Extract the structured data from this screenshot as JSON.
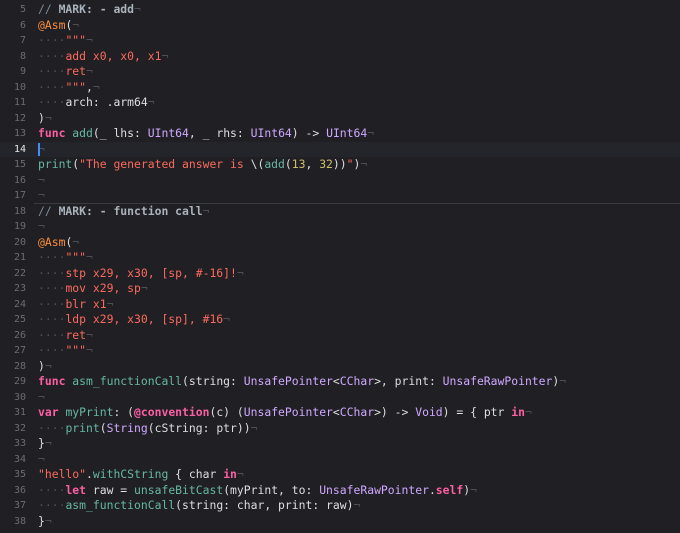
{
  "editor": {
    "current_line": "14",
    "lines": [
      {
        "n": "5",
        "t": [
          [
            "comment",
            "// "
          ],
          [
            "mark",
            "MARK: - add"
          ],
          [
            "inv",
            "¬"
          ]
        ]
      },
      {
        "n": "6",
        "t": [
          [
            "attr",
            "@Asm"
          ],
          [
            "plain",
            "("
          ],
          [
            "inv",
            "¬"
          ]
        ]
      },
      {
        "n": "7",
        "t": [
          [
            "inv",
            "····"
          ],
          [
            "str",
            "\"\"\""
          ],
          [
            "inv",
            "¬"
          ]
        ]
      },
      {
        "n": "8",
        "t": [
          [
            "inv",
            "····"
          ],
          [
            "str",
            "add x0, x0, x1"
          ],
          [
            "inv",
            "¬"
          ]
        ]
      },
      {
        "n": "9",
        "t": [
          [
            "inv",
            "····"
          ],
          [
            "str",
            "ret"
          ],
          [
            "inv",
            "¬"
          ]
        ]
      },
      {
        "n": "10",
        "t": [
          [
            "inv",
            "····"
          ],
          [
            "str",
            "\"\"\""
          ],
          [
            "plain",
            ","
          ],
          [
            "inv",
            "¬"
          ]
        ]
      },
      {
        "n": "11",
        "t": [
          [
            "inv",
            "····"
          ],
          [
            "plain",
            "arch: .arm64"
          ],
          [
            "inv",
            "¬"
          ]
        ]
      },
      {
        "n": "12",
        "t": [
          [
            "plain",
            ")"
          ],
          [
            "inv",
            "¬"
          ]
        ]
      },
      {
        "n": "13",
        "t": [
          [
            "kw",
            "func"
          ],
          [
            "plain",
            " "
          ],
          [
            "func",
            "add"
          ],
          [
            "plain",
            "(_ lhs: "
          ],
          [
            "type",
            "UInt64"
          ],
          [
            "plain",
            ", _ rhs: "
          ],
          [
            "type",
            "UInt64"
          ],
          [
            "plain",
            ") -> "
          ],
          [
            "type",
            "UInt64"
          ],
          [
            "inv",
            "¬"
          ]
        ]
      },
      {
        "n": "14",
        "t": [
          [
            "inv",
            "¬"
          ]
        ]
      },
      {
        "n": "15",
        "t": [
          [
            "func",
            "print"
          ],
          [
            "plain",
            "("
          ],
          [
            "str",
            "\"The generated answer is "
          ],
          [
            "plain",
            "\\("
          ],
          [
            "func",
            "add"
          ],
          [
            "plain",
            "("
          ],
          [
            "num",
            "13"
          ],
          [
            "plain",
            ", "
          ],
          [
            "num",
            "32"
          ],
          [
            "plain",
            "))"
          ],
          [
            "str",
            "\""
          ],
          [
            "plain",
            ")"
          ],
          [
            "inv",
            "¬"
          ]
        ]
      },
      {
        "n": "16",
        "t": [
          [
            "inv",
            "¬"
          ]
        ]
      },
      {
        "n": "17",
        "t": [
          [
            "inv",
            "¬"
          ]
        ]
      },
      {
        "n": "18",
        "t": [
          [
            "comment",
            "// "
          ],
          [
            "mark",
            "MARK: - function call"
          ],
          [
            "inv",
            "¬"
          ]
        ]
      },
      {
        "n": "19",
        "t": [
          [
            "inv",
            "¬"
          ]
        ]
      },
      {
        "n": "20",
        "t": [
          [
            "attr",
            "@Asm"
          ],
          [
            "plain",
            "("
          ],
          [
            "inv",
            "¬"
          ]
        ]
      },
      {
        "n": "21",
        "t": [
          [
            "inv",
            "····"
          ],
          [
            "str",
            "\"\"\""
          ],
          [
            "inv",
            "¬"
          ]
        ]
      },
      {
        "n": "22",
        "t": [
          [
            "inv",
            "····"
          ],
          [
            "str",
            "stp x29, x30, [sp, #-16]!"
          ],
          [
            "inv",
            "¬"
          ]
        ]
      },
      {
        "n": "23",
        "t": [
          [
            "inv",
            "····"
          ],
          [
            "str",
            "mov x29, sp"
          ],
          [
            "inv",
            "¬"
          ]
        ]
      },
      {
        "n": "24",
        "t": [
          [
            "inv",
            "····"
          ],
          [
            "str",
            "blr x1"
          ],
          [
            "inv",
            "¬"
          ]
        ]
      },
      {
        "n": "25",
        "t": [
          [
            "inv",
            "····"
          ],
          [
            "str",
            "ldp x29, x30, [sp], #16"
          ],
          [
            "inv",
            "¬"
          ]
        ]
      },
      {
        "n": "26",
        "t": [
          [
            "inv",
            "····"
          ],
          [
            "str",
            "ret"
          ],
          [
            "inv",
            "¬"
          ]
        ]
      },
      {
        "n": "27",
        "t": [
          [
            "inv",
            "····"
          ],
          [
            "str",
            "\"\"\""
          ],
          [
            "inv",
            "¬"
          ]
        ]
      },
      {
        "n": "28",
        "t": [
          [
            "plain",
            ")"
          ],
          [
            "inv",
            "¬"
          ]
        ]
      },
      {
        "n": "29",
        "t": [
          [
            "kw",
            "func"
          ],
          [
            "plain",
            " "
          ],
          [
            "func",
            "asm_functionCall"
          ],
          [
            "plain",
            "(string: "
          ],
          [
            "type",
            "UnsafePointer"
          ],
          [
            "plain",
            "<"
          ],
          [
            "type",
            "CChar"
          ],
          [
            "plain",
            ">, print: "
          ],
          [
            "type",
            "UnsafeRawPointer"
          ],
          [
            "plain",
            ")"
          ],
          [
            "inv",
            "¬"
          ]
        ]
      },
      {
        "n": "30",
        "t": [
          [
            "inv",
            "¬"
          ]
        ]
      },
      {
        "n": "31",
        "t": [
          [
            "kw",
            "var"
          ],
          [
            "plain",
            " "
          ],
          [
            "func",
            "myPrint"
          ],
          [
            "plain",
            ": ("
          ],
          [
            "kw",
            "@convention"
          ],
          [
            "plain",
            "(c) ("
          ],
          [
            "type",
            "UnsafePointer"
          ],
          [
            "plain",
            "<"
          ],
          [
            "type",
            "CChar"
          ],
          [
            "plain",
            ">) -> "
          ],
          [
            "type",
            "Void"
          ],
          [
            "plain",
            ") = { ptr "
          ],
          [
            "kw",
            "in"
          ],
          [
            "inv",
            "¬"
          ]
        ]
      },
      {
        "n": "32",
        "t": [
          [
            "inv",
            "····"
          ],
          [
            "func",
            "print"
          ],
          [
            "plain",
            "("
          ],
          [
            "type",
            "String"
          ],
          [
            "plain",
            "(cString: ptr))"
          ],
          [
            "inv",
            "¬"
          ]
        ]
      },
      {
        "n": "33",
        "t": [
          [
            "plain",
            "}"
          ],
          [
            "inv",
            "¬"
          ]
        ]
      },
      {
        "n": "34",
        "t": [
          [
            "inv",
            "¬"
          ]
        ]
      },
      {
        "n": "35",
        "t": [
          [
            "str",
            "\"hello\""
          ],
          [
            "plain",
            "."
          ],
          [
            "func",
            "withCString"
          ],
          [
            "plain",
            " { char "
          ],
          [
            "kw",
            "in"
          ],
          [
            "inv",
            "¬"
          ]
        ]
      },
      {
        "n": "36",
        "t": [
          [
            "inv",
            "····"
          ],
          [
            "kw",
            "let"
          ],
          [
            "plain",
            " raw = "
          ],
          [
            "func",
            "unsafeBitCast"
          ],
          [
            "plain",
            "(myPrint, to: "
          ],
          [
            "type",
            "UnsafeRawPointer"
          ],
          [
            "plain",
            "."
          ],
          [
            "kw",
            "self"
          ],
          [
            "plain",
            ")"
          ],
          [
            "inv",
            "¬"
          ]
        ]
      },
      {
        "n": "37",
        "t": [
          [
            "inv",
            "····"
          ],
          [
            "func",
            "asm_functionCall"
          ],
          [
            "plain",
            "(string: char, print: raw)"
          ],
          [
            "inv",
            "¬"
          ]
        ]
      },
      {
        "n": "38",
        "t": [
          [
            "plain",
            "}"
          ],
          [
            "inv",
            "¬"
          ]
        ]
      }
    ]
  }
}
